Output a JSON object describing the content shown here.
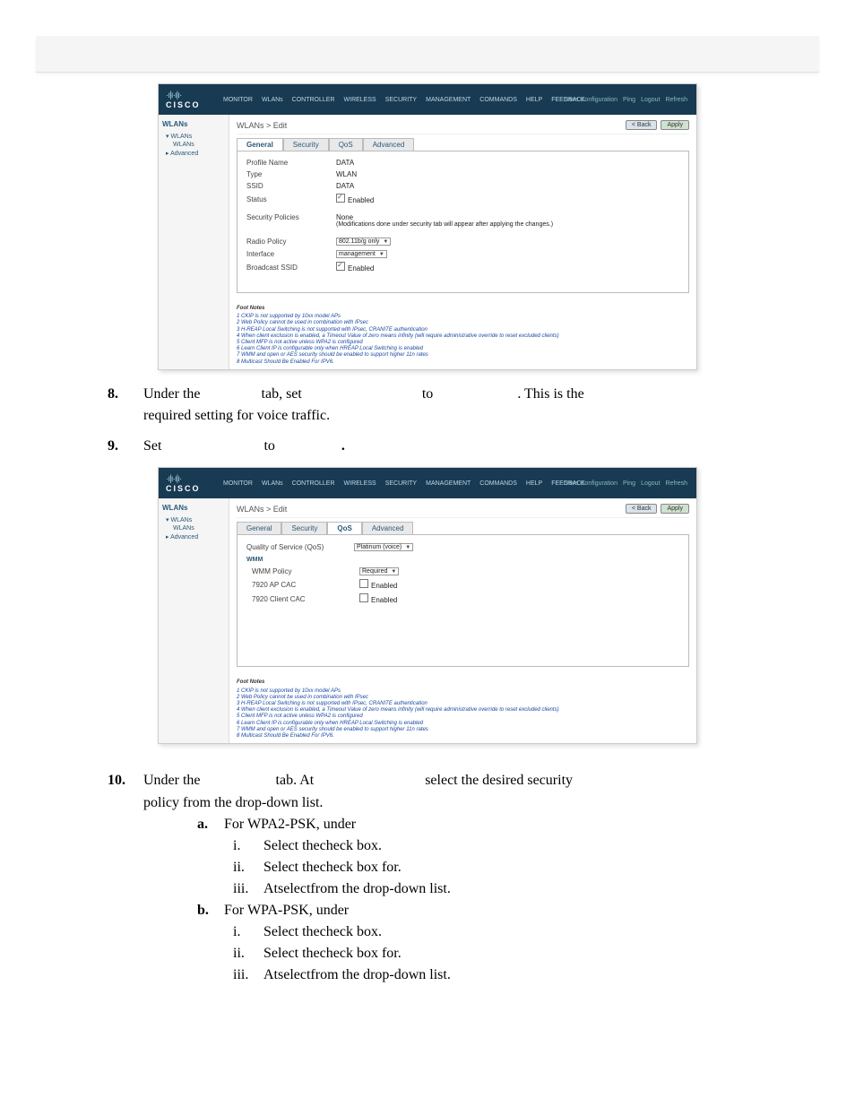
{
  "cisco": {
    "dots": "·ı|ı·ı|ı·",
    "brand": "CISCO",
    "toplinks": [
      "Save Configuration",
      "Ping",
      "Logout",
      "Refresh"
    ],
    "nav": [
      "MONITOR",
      "WLANs",
      "CONTROLLER",
      "WIRELESS",
      "SECURITY",
      "MANAGEMENT",
      "COMMANDS",
      "HELP",
      "FEEDBACK"
    ],
    "side_hdr": "WLANs",
    "side_group": "WLANs",
    "side_sub": "WLANs",
    "side_adv": "Advanced",
    "breadcrumb": "WLANs > Edit",
    "back_btn": "< Back",
    "apply_btn": "Apply",
    "tabs": {
      "general": "General",
      "security": "Security",
      "qos": "QoS",
      "advanced": "Advanced"
    },
    "footnotes_title": "Foot Notes",
    "footnotes": [
      "1 CKIP is not supported by 10xx model APs",
      "2 Web Policy cannot be used in combination with IPsec",
      "3 H-REAP Local Switching is not supported with IPsec, CRANITE authentication",
      "4 When client exclusion is enabled, a Timeout Value of zero means infinity (will require administrative override to reset excluded clients)",
      "5 Client MFP is not active unless WPA2 is configured",
      "6 Learn Client IP is configurable only when HREAP Local Switching is enabled",
      "7 WMM and open or AES security should be enabled to support higher 11n rates",
      "8 Multicast Should Be Enabled For IPV6."
    ]
  },
  "shot1": {
    "rows": {
      "profile_name": {
        "label": "Profile Name",
        "value": "DATA"
      },
      "type": {
        "label": "Type",
        "value": "WLAN"
      },
      "ssid": {
        "label": "SSID",
        "value": "DATA"
      },
      "status": {
        "label": "Status",
        "value": "Enabled"
      },
      "sec_pol": {
        "label": "Security Policies",
        "value": "None",
        "note": "(Modifications done under security tab will appear after applying the changes.)"
      },
      "radio": {
        "label": "Radio Policy",
        "value": "802.11b/g only"
      },
      "interface": {
        "label": "Interface",
        "value": "management"
      },
      "bcast": {
        "label": "Broadcast SSID",
        "value": "Enabled"
      }
    }
  },
  "shot2": {
    "qos": {
      "label": "Quality of Service (QoS)",
      "value": "Platinum (voice)"
    },
    "wmm_hdr": "WMM",
    "wmm_policy": {
      "label": "WMM Policy",
      "value": "Required"
    },
    "ap_cac": {
      "label": "7920 AP CAC",
      "value": "Enabled"
    },
    "client_cac": {
      "label": "7920 Client CAC",
      "value": "Enabled"
    }
  },
  "steps": {
    "s8": {
      "num": "8.",
      "p1": "Under the",
      "p2": "tab, set",
      "p3": "to",
      "p4": ". This is the",
      "cont": "required setting for voice traffic."
    },
    "s9": {
      "num": "9.",
      "p1": "Set",
      "p2": "to",
      "p3": "."
    },
    "s10": {
      "num": "10.",
      "p1": "Under the",
      "p2": "tab. At",
      "p3": "select the desired security",
      "cont": "policy from the drop-down list."
    },
    "sa": {
      "num": "a.",
      "text": "For WPA2-PSK, under"
    },
    "sa_i": {
      "num": "i.",
      "p1": "Select the",
      "p2": "check box."
    },
    "sa_ii": {
      "num": "ii.",
      "p1": "Select the",
      "p2": "check box for",
      "p3": "."
    },
    "sa_iii": {
      "num": "iii.",
      "p1": "At",
      "p2": "select",
      "p3": "from the drop-down list."
    },
    "sb": {
      "num": "b.",
      "text": "For WPA-PSK, under"
    },
    "sb_i": {
      "num": "i.",
      "p1": "Select the",
      "p2": "check box."
    },
    "sb_ii": {
      "num": "ii.",
      "p1": "Select the",
      "p2": "check box for",
      "p3": "."
    },
    "sb_iii": {
      "num": "iii.",
      "p1": "At",
      "p2": "select",
      "p3": "from the drop-down list."
    }
  }
}
